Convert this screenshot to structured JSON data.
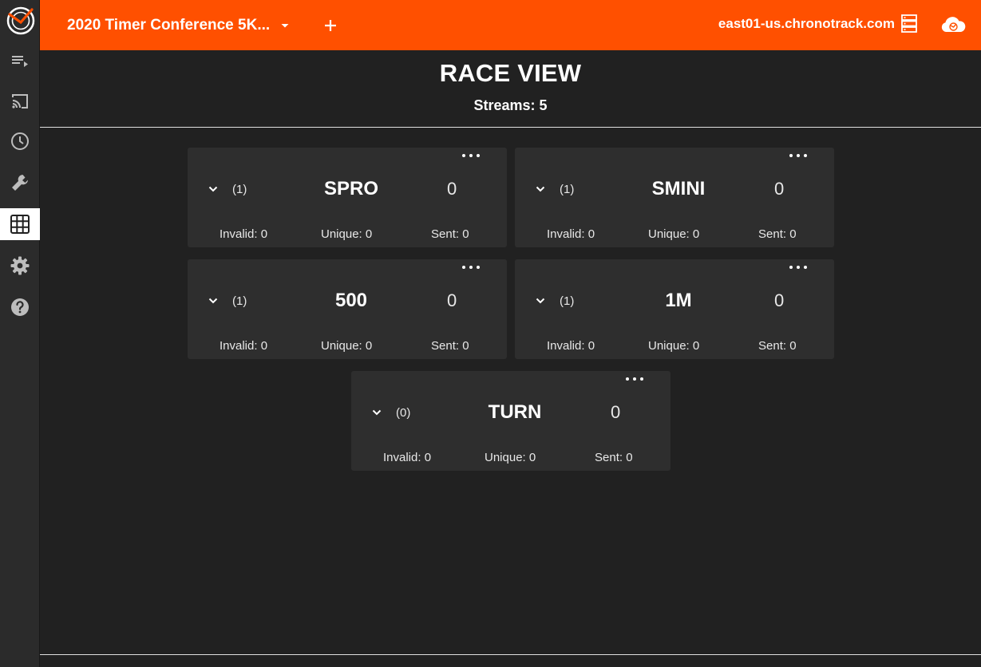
{
  "app": {
    "race_title": "2020 Timer Conference 5K...",
    "server_host": "east01-us.chronotrack.com"
  },
  "sidebar": {
    "items": [
      {
        "name": "playlist-icon",
        "active": false
      },
      {
        "name": "cast-icon",
        "active": false
      },
      {
        "name": "clock-icon",
        "active": false
      },
      {
        "name": "wrench-icon",
        "active": false
      },
      {
        "name": "grid-icon",
        "active": true
      },
      {
        "name": "gear-icon",
        "active": false
      },
      {
        "name": "help-icon",
        "active": false
      }
    ]
  },
  "header": {
    "title": "RACE VIEW",
    "streams": "Streams: 5"
  },
  "cards": [
    {
      "count": "(1)",
      "name": "SPRO",
      "total": "0",
      "invalid": "Invalid: 0",
      "unique": "Unique: 0",
      "sent": "Sent: 0"
    },
    {
      "count": "(1)",
      "name": "SMINI",
      "total": "0",
      "invalid": "Invalid: 0",
      "unique": "Unique: 0",
      "sent": "Sent: 0"
    },
    {
      "count": "(1)",
      "name": "500",
      "total": "0",
      "invalid": "Invalid: 0",
      "unique": "Unique: 0",
      "sent": "Sent: 0"
    },
    {
      "count": "(1)",
      "name": "1M",
      "total": "0",
      "invalid": "Invalid: 0",
      "unique": "Unique: 0",
      "sent": "Sent: 0"
    },
    {
      "count": "(0)",
      "name": "TURN",
      "total": "0",
      "invalid": "Invalid: 0",
      "unique": "Unique: 0",
      "sent": "Sent: 0"
    }
  ],
  "colors": {
    "accent": "#ff5000",
    "background": "#212121",
    "card": "#2e2e2e",
    "sidebar": "#2b2b2b"
  }
}
